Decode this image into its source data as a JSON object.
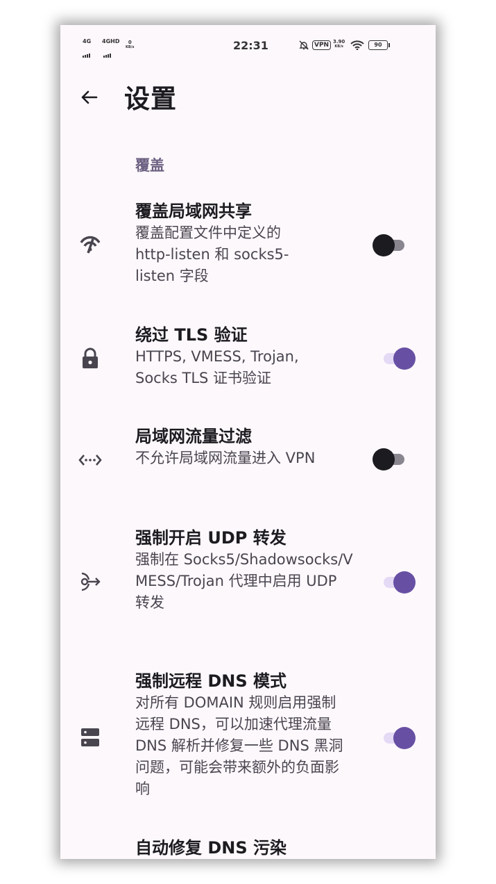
{
  "status_bar": {
    "net1": "4G",
    "net2": "4GHD",
    "speed_left_value": "0",
    "speed_left_unit": "KB/s",
    "time": "22:31",
    "vpn": "VPN",
    "speed_right_value": "3.90",
    "speed_right_unit": "KB/s",
    "battery": "90"
  },
  "header": {
    "title": "设置"
  },
  "section": {
    "title": "覆盖"
  },
  "settings": [
    {
      "title": "覆盖局域网共享",
      "description": "覆盖配置文件中定义的 http-listen 和 socks5-listen 字段",
      "icon": "wifi-tethering-icon",
      "enabled": false
    },
    {
      "title": "绕过 TLS 验证",
      "description": "HTTPS, VMESS, Trojan, Socks TLS 证书验证",
      "icon": "lock-icon",
      "enabled": true
    },
    {
      "title": "局域网流量过滤",
      "description": "不允许局域网流量进入 VPN",
      "icon": "lan-filter-icon",
      "enabled": false
    },
    {
      "title": "强制开启 UDP 转发",
      "description": "强制在 Socks5/Shadowsocks/VMESS/Trojan 代理中启用 UDP 转发",
      "icon": "udp-forward-icon",
      "enabled": true
    },
    {
      "title": "强制远程 DNS 模式",
      "description": "对所有 DOMAIN 规则启用强制远程 DNS，可以加速代理流量 DNS 解析并修复一些 DNS 黑洞问题，可能会带来额外的负面影响",
      "icon": "dns-server-icon",
      "enabled": true
    },
    {
      "title": "自动修复 DNS 污染",
      "description": "",
      "icon": "dns-repair-icon",
      "enabled": null
    }
  ]
}
